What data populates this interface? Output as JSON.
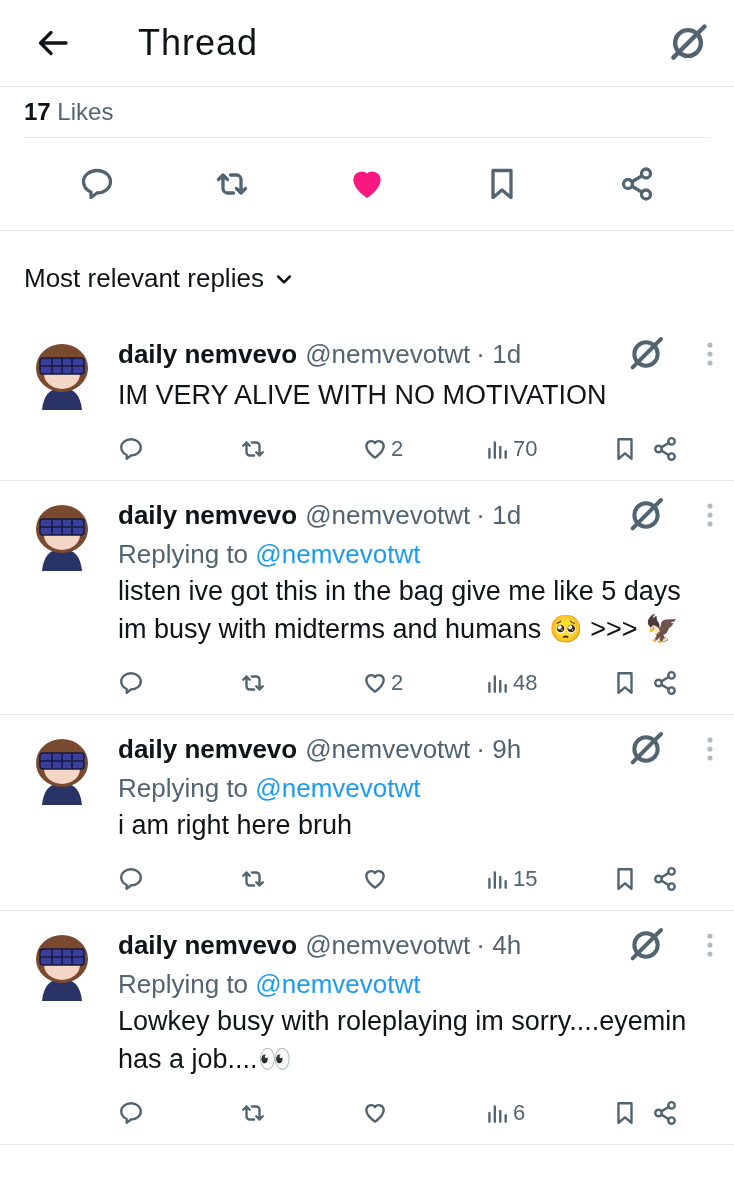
{
  "header": {
    "title": "Thread"
  },
  "likes_summary": "**17** Likes",
  "main_actions": {
    "liked": true
  },
  "sort": {
    "label": "Most relevant replies"
  },
  "replies": [
    {
      "name": "daily nemvevo",
      "handle": "@nemvevotwt",
      "time": "· 1d",
      "text": "IM VERY ALIVE WITH NO MOTIVATION",
      "likes": "2",
      "views": "70",
      "liked": false
    },
    {
      "name": "daily nemvevo",
      "handle": "@nemvevotwt",
      "time": "· 1d",
      "replying_label": "Replying to",
      "replying_to": "@nemvevotwt",
      "text": "listen ive got this in the bag give me like 5 days im busy with midterms and humans 🥺 >>> 🦅",
      "likes": "2",
      "views": "48",
      "liked": false
    },
    {
      "name": "daily nemvevo",
      "handle": "@nemvevotwt",
      "time": "· 9h",
      "replying_label": "Replying to",
      "replying_to": "@nemvevotwt",
      "text": "i am right here bruh",
      "views": "15",
      "liked": false
    },
    {
      "name": "daily nemvevo",
      "handle": "@nemvevotwt",
      "time": "· 4h",
      "replying_label": "Replying to",
      "replying_to": "@nemvevotwt",
      "text": "Lowkey busy with roleplaying im sorry....eyemin has a job....👀",
      "views": "6",
      "liked": false
    }
  ]
}
